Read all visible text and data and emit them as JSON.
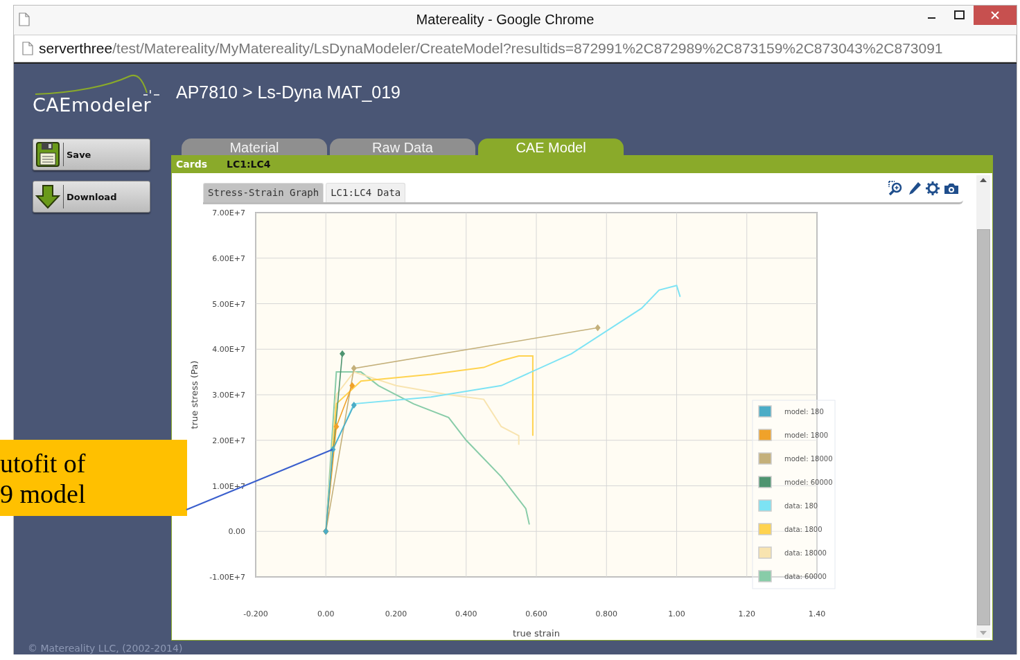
{
  "window": {
    "title": "Matereality - Google Chrome"
  },
  "address_bar": {
    "host": "serverthree",
    "path": "/test/Matereality/MyMatereality/LsDynaModeler/CreateModel?resultids=872991%2C872989%2C873159%2C873043%2C873091"
  },
  "header": {
    "logo": "CAEmodeler",
    "breadcrumb": "AP7810 > Ls-Dyna MAT_019"
  },
  "sidebar": {
    "buttons": [
      {
        "label": "Save",
        "kind": "save"
      },
      {
        "label": "Download",
        "kind": "download"
      }
    ]
  },
  "tabs": [
    {
      "label": "Material",
      "selected": false
    },
    {
      "label": "Raw Data",
      "selected": false
    },
    {
      "label": "CAE Model",
      "selected": true
    }
  ],
  "cards_bar": {
    "label": "Cards",
    "value": "LC1:LC4"
  },
  "subtabs": [
    {
      "label": "Stress-Strain Graph",
      "selected": true
    },
    {
      "label": "LC1:LC4 Data",
      "selected": false
    }
  ],
  "chart_data": {
    "type": "line",
    "xlabel": "true strain",
    "ylabel": "true stress (Pa)",
    "xlim": [
      -0.2,
      1.4
    ],
    "ylim": [
      -10000000,
      70000000
    ],
    "xticks": [
      {
        "value": -0.2,
        "label": "-0.200"
      },
      {
        "value": 0,
        "label": "0.00"
      },
      {
        "value": 0.2,
        "label": "0.200"
      },
      {
        "value": 0.4,
        "label": "0.400"
      },
      {
        "value": 0.6,
        "label": "0.600"
      },
      {
        "value": 0.8,
        "label": "0.800"
      },
      {
        "value": 1,
        "label": "1.00"
      },
      {
        "value": 1.2,
        "label": "1.20"
      },
      {
        "value": 1.4,
        "label": "1.40"
      }
    ],
    "yticks": [
      {
        "value": -10000000,
        "label": "-1.00E+7"
      },
      {
        "value": 0,
        "label": "0.00"
      },
      {
        "value": 10000000,
        "label": "1.00E+7"
      },
      {
        "value": 20000000,
        "label": "2.00E+7"
      },
      {
        "value": 30000000,
        "label": "3.00E+7"
      },
      {
        "value": 40000000,
        "label": "4.00E+7"
      },
      {
        "value": 50000000,
        "label": "5.00E+7"
      },
      {
        "value": 60000000,
        "label": "6.00E+7"
      },
      {
        "value": 70000000,
        "label": "7.00E+7"
      }
    ],
    "grid": true,
    "legend": true,
    "series": [
      {
        "name": "model: 180",
        "marker": "diamond",
        "color": "#4bacc6",
        "x": [
          0,
          0.02,
          0.08
        ],
        "values": [
          0,
          18000000,
          27700000
        ]
      },
      {
        "name": "model: 1800",
        "marker": "diamond",
        "color": "#f0a22a",
        "x": [
          0,
          0.03,
          0.075
        ],
        "values": [
          0,
          23000000,
          32000000
        ]
      },
      {
        "name": "model: 18000",
        "marker": "diamond",
        "color": "#c4b07a",
        "x": [
          0,
          0.08,
          0.775
        ],
        "values": [
          0,
          35800000,
          44700000
        ]
      },
      {
        "name": "model: 60000",
        "marker": "diamond",
        "color": "#4e9470",
        "x": [
          0,
          0.047
        ],
        "values": [
          0,
          39000000
        ]
      },
      {
        "name": "data: 180",
        "color": "#7de3f4",
        "x": [
          0,
          0.02,
          0.08,
          0.3,
          0.5,
          0.7,
          0.9,
          0.95,
          1.0,
          1.01
        ],
        "values": [
          0,
          18000000,
          28000000,
          29500000,
          32000000,
          39000000,
          49000000,
          53000000,
          54000000,
          51500000
        ]
      },
      {
        "name": "data: 1800",
        "color": "#ffd34f",
        "x": [
          0,
          0.03,
          0.1,
          0.3,
          0.45,
          0.5,
          0.55,
          0.59,
          0.59
        ],
        "values": [
          0,
          28000000,
          33000000,
          34500000,
          36000000,
          37500000,
          38500000,
          38500000,
          21000000
        ]
      },
      {
        "name": "data: 18000",
        "color": "#f8e4b0",
        "x": [
          0,
          0.03,
          0.08,
          0.2,
          0.35,
          0.45,
          0.5,
          0.55,
          0.55
        ],
        "values": [
          0,
          30000000,
          35000000,
          32000000,
          30000000,
          29000000,
          23000000,
          21000000,
          19000000
        ]
      },
      {
        "name": "data: 60000",
        "color": "#88cca8",
        "x": [
          0,
          0.03,
          0.1,
          0.15,
          0.25,
          0.35,
          0.4,
          0.5,
          0.57,
          0.58
        ],
        "values": [
          0,
          35000000,
          35000000,
          32000000,
          28000000,
          25000000,
          20000000,
          12000000,
          5000000,
          1500000
        ]
      }
    ]
  },
  "footer": "© Matereality LLC, (2002-2014)",
  "callout": {
    "lines": [
      "utofit of",
      "9 model"
    ]
  }
}
